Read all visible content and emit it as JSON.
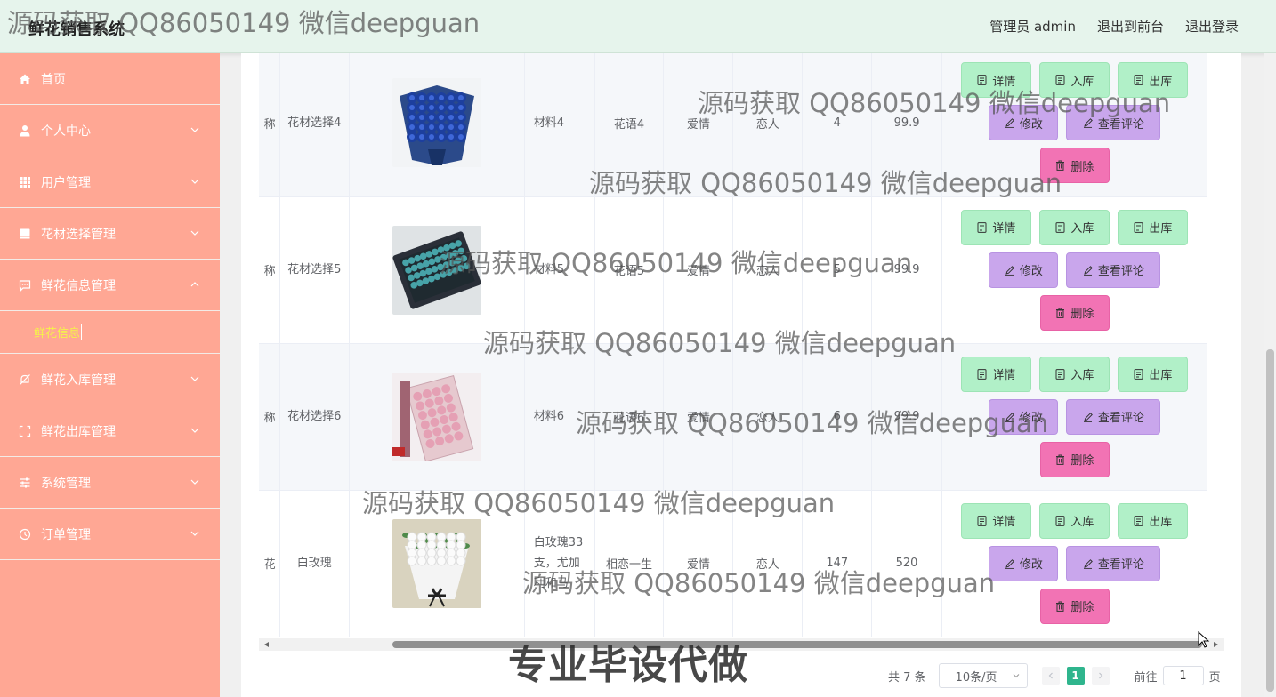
{
  "header": {
    "brand": "鲜花销售系统",
    "user_label": "管理员 admin",
    "front_link": "退出到前台",
    "logout_link": "退出登录"
  },
  "sidebar": {
    "items": [
      {
        "label": "首页",
        "icon": "home-icon",
        "expandable": false
      },
      {
        "label": "个人中心",
        "icon": "user-icon",
        "expandable": true
      },
      {
        "label": "用户管理",
        "icon": "grid-icon",
        "expandable": true
      },
      {
        "label": "花材选择管理",
        "icon": "book-icon",
        "expandable": true
      },
      {
        "label": "鲜花信息管理",
        "icon": "chat-icon",
        "expandable": true,
        "expanded": true
      },
      {
        "label": "鲜花入库管理",
        "icon": "bell-off-icon",
        "expandable": true
      },
      {
        "label": "鲜花出库管理",
        "icon": "fullscreen-icon",
        "expandable": true
      },
      {
        "label": "系统管理",
        "icon": "sliders-icon",
        "expandable": true
      },
      {
        "label": "订单管理",
        "icon": "clock-icon",
        "expandable": true
      }
    ],
    "submenu_active": "鲜花信息"
  },
  "table": {
    "rows": [
      {
        "name_part": "称",
        "material_choice": "花材选择4",
        "image": "blue-rose-bouquet",
        "material": "材料4",
        "flower_language": "花语4",
        "category": "爱情",
        "target": "恋人",
        "stock": "4",
        "price": "99.9"
      },
      {
        "name_part": "称",
        "material_choice": "花材选择5",
        "image": "teal-rose-gift-box",
        "material": "材料5",
        "flower_language": "花语5",
        "category": "爱情",
        "target": "恋人",
        "stock": "5",
        "price": "99.9"
      },
      {
        "name_part": "称",
        "material_choice": "花材选择6",
        "image": "pink-rose-box",
        "material": "材料6",
        "flower_language": "花语6",
        "category": "爱情",
        "target": "恋人",
        "stock": "6",
        "price": "99.9"
      },
      {
        "name_part": "花",
        "material_choice": "白玫瑰",
        "image": "white-rose-bouquet",
        "material": "白玫瑰33支，尤加利和马",
        "flower_language": "相恋一生",
        "category": "爱情",
        "target": "恋人",
        "stock": "147",
        "price": "520"
      }
    ],
    "actions": {
      "detail": "详情",
      "stock_in": "入库",
      "stock_out": "出库",
      "edit": "修改",
      "view_reviews": "查看评论",
      "delete": "删除"
    }
  },
  "pagination": {
    "total": "共 7 条",
    "page_size": "10条/页",
    "current_page": "1",
    "goto_label": "前往",
    "goto_value": "1",
    "page_suffix": "页"
  },
  "watermarks": {
    "contact": "源码获取 QQ86050149 微信deepguan",
    "banner": "专业毕设代做"
  },
  "colors": {
    "header_bg": "#e6f4ec",
    "sidebar_bg": "#ffa794",
    "submenu_active": "#f5f34a",
    "btn_green": "#b1f0c8",
    "btn_purple": "#c9a6ec",
    "btn_pink": "#f273b4",
    "page_active": "#2fb58d"
  }
}
